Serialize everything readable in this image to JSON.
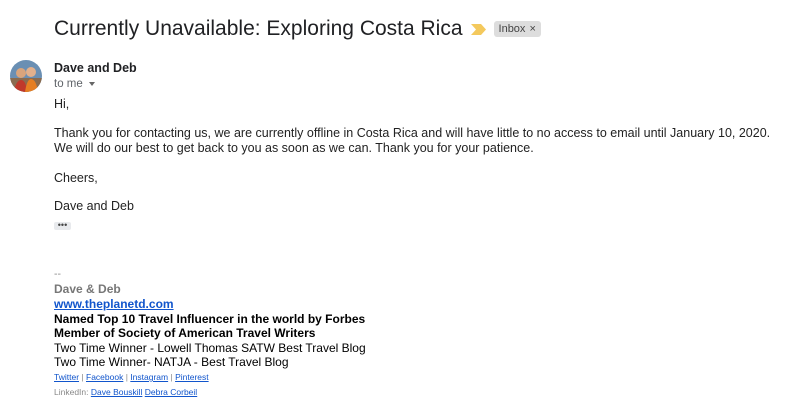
{
  "subject": "Currently Unavailable: Exploring Costa Rica",
  "importance_icon": "importance-marker-icon",
  "label": {
    "text": "Inbox",
    "close_glyph": "×"
  },
  "sender": {
    "name": "Dave and Deb",
    "to": "to me",
    "avatar": "avatar-photo"
  },
  "body": {
    "greeting": "Hi,",
    "line1": "Thank you for contacting us, we are currently offline in Costa Rica and will have little to no access to email until January 10, 2020.",
    "line2": "We will do our best to get back to you as soon as we can. Thank you for your patience.",
    "closing": "Cheers,",
    "signoff": "Dave and Deb",
    "trimmed_glyph": "•••"
  },
  "signature": {
    "dashes": "--",
    "name": "Dave & Deb",
    "website": "www.theplanetd.com",
    "line1": "Named Top 10 Travel Influencer in the world by Forbes",
    "line2": "Member of Society of American Travel Writers",
    "line3": "Two Time Winner - Lowell Thomas SATW Best Travel Blog",
    "line4": "Two Time Winner-  NATJA - Best Travel Blog",
    "social": [
      "Twitter",
      "Facebook",
      "Instagram",
      "Pinterest"
    ],
    "separator": "|",
    "linkedin_label": "LinkedIn:",
    "linkedin": [
      "Dave Bouskill",
      "Debra Corbeil"
    ]
  },
  "colors": {
    "link": "#1155cc",
    "importance": "#f4c95d",
    "chip_bg": "#dddddd"
  }
}
